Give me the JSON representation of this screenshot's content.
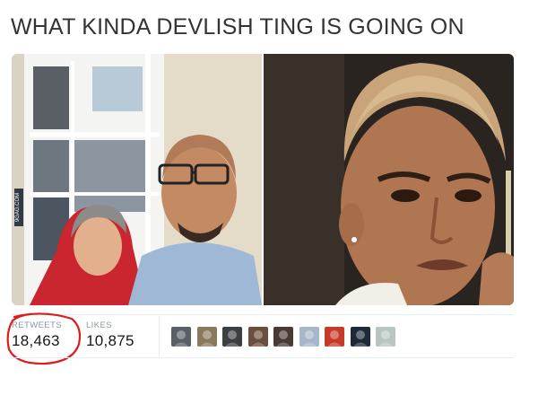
{
  "tweet": {
    "text": "WHAT KINDA DEVLISH TING IS GOING ON"
  },
  "media": {
    "left_photo_watermark": "9GAG.COM",
    "images": [
      {
        "name": "couple-selfie-photo"
      },
      {
        "name": "man-suspicious-look-photo"
      }
    ]
  },
  "stats": {
    "retweets_label": "RETWEETS",
    "retweets_count": "18,463",
    "likes_label": "LIKES",
    "likes_count": "10,875"
  },
  "annotation": {
    "color": "#e01b1b",
    "target": "retweets"
  },
  "likers": {
    "count": 9,
    "avatar_colors": [
      "#5a5f66",
      "#8a7a5c",
      "#3b3f44",
      "#6b4e3d",
      "#4a3a36",
      "#a7b6c9",
      "#c63a2a",
      "#1e2a3a",
      "#b9c5c0"
    ]
  },
  "colors": {
    "text_primary": "#333333",
    "stat_label": "#8899a6",
    "divider": "#e6ecf0"
  }
}
